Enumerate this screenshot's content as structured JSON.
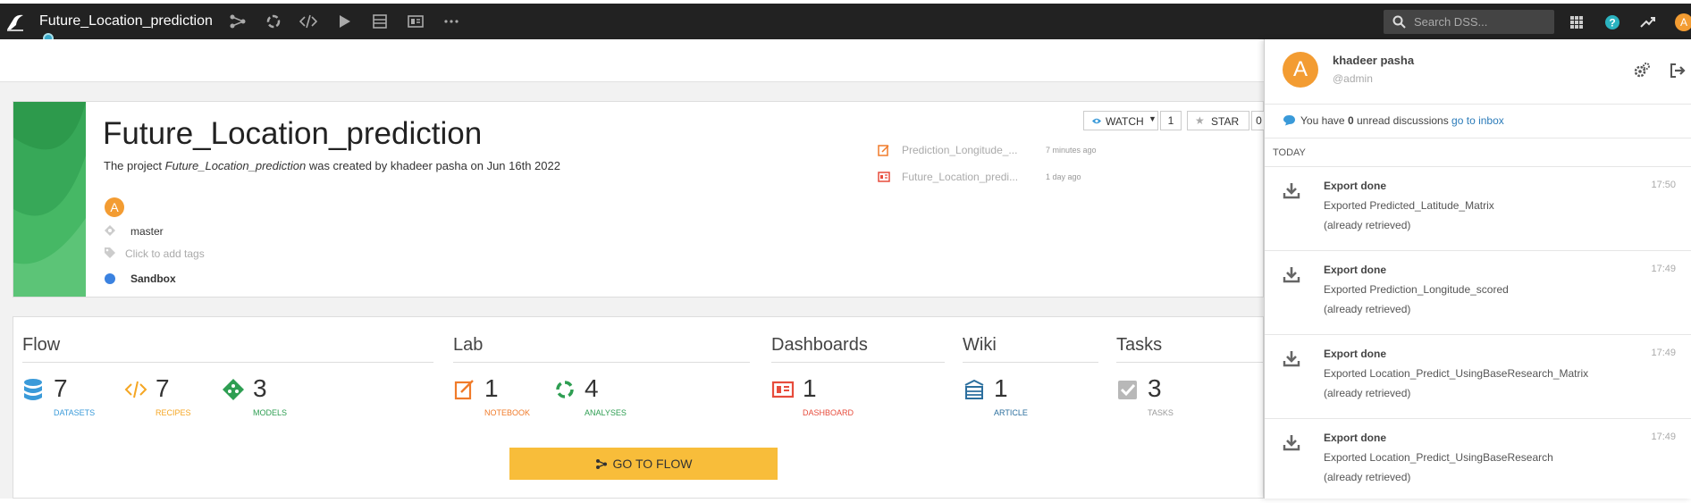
{
  "app": {
    "project_name": "Future_Location_prediction",
    "search_placeholder": "Search DSS...",
    "user_initial": "A"
  },
  "project": {
    "title": "Future_Location_prediction",
    "desc_prefix": "The project ",
    "desc_name": "Future_Location_prediction",
    "desc_suffix": " was created by khadeer pasha on Jun 16th 2022",
    "owner_initial": "A",
    "branch": "master",
    "tags_placeholder": "Click to add tags",
    "status": "Sandbox",
    "watch_label": "WATCH",
    "watch_count": "1",
    "star_label": "STAR",
    "star_count": "0"
  },
  "recent": [
    {
      "name": "Prediction_Longitude_...",
      "time": "7 minutes ago",
      "icon": "notebook-icon"
    },
    {
      "name": "Future_Location_predi...",
      "time": "1 day ago",
      "icon": "dashboard-icon"
    }
  ],
  "sections": {
    "flow": "Flow",
    "lab": "Lab",
    "dashboards": "Dashboards",
    "wiki": "Wiki",
    "tasks": "Tasks"
  },
  "stats": {
    "datasets": {
      "num": "7",
      "label": "DATASETS"
    },
    "recipes": {
      "num": "7",
      "label": "RECIPES"
    },
    "models": {
      "num": "3",
      "label": "MODELS"
    },
    "notebook": {
      "num": "1",
      "label": "NOTEBOOK"
    },
    "analyses": {
      "num": "4",
      "label": "ANALYSES"
    },
    "dashboard": {
      "num": "1",
      "label": "DASHBOARD"
    },
    "article": {
      "num": "1",
      "label": "ARTICLE"
    },
    "tasks": {
      "num": "3",
      "label": "TASKS"
    }
  },
  "go_to_flow": "GO TO FLOW",
  "panel": {
    "avatar": "A",
    "user_name": "khadeer pasha",
    "user_login": "@admin",
    "inbox_prefix": "You have ",
    "inbox_count": "0",
    "inbox_middle": " unread discussions ",
    "inbox_link": "go to inbox",
    "today": "TODAY",
    "notifications": [
      {
        "title": "Export done",
        "desc": "Exported Predicted_Latitude_Matrix",
        "sub": "(already retrieved)",
        "time": "17:50"
      },
      {
        "title": "Export done",
        "desc": "Exported Prediction_Longitude_scored",
        "sub": "(already retrieved)",
        "time": "17:49"
      },
      {
        "title": "Export done",
        "desc": "Exported Location_Predict_UsingBaseResearch_Matrix",
        "sub": "(already retrieved)",
        "time": "17:49"
      },
      {
        "title": "Export done",
        "desc": "Exported Location_Predict_UsingBaseResearch",
        "sub": "(already retrieved)",
        "time": "17:49"
      }
    ]
  },
  "colors": {
    "topbar": "#222222",
    "accent_yellow": "#f8bd3a",
    "datasets": "#3a9ad9",
    "recipes": "#f5a623",
    "models": "#2e9e52",
    "notebook": "#f07b2a",
    "analyses": "#2e9e52",
    "dashboard": "#e74c3c",
    "article": "#2c6f9e",
    "tasks": "#999999"
  }
}
